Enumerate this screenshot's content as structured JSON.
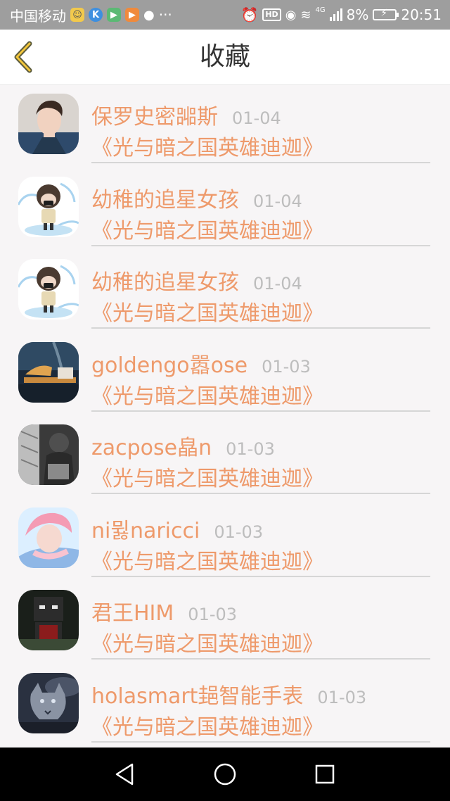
{
  "status_bar": {
    "carrier": "中国移动",
    "more": "···",
    "network": "4G",
    "battery": "8%",
    "time": "20:51",
    "hd": "HD"
  },
  "header": {
    "title": "收藏",
    "back_icon": "chevron-left-icon"
  },
  "favorites": [
    {
      "name": "保罗史密嘂斯",
      "date": "01-04",
      "title": "《光与暗之国英雄迪迦》",
      "avatar": "portrait-man"
    },
    {
      "name": "幼稚的追星女孩",
      "date": "01-04",
      "title": "《光与暗之国英雄迪迦》",
      "avatar": "cartoon-boy"
    },
    {
      "name": "幼稚的追星女孩",
      "date": "01-04",
      "title": "《光与暗之国英雄迪迦》",
      "avatar": "cartoon-boy"
    },
    {
      "name": "goldengo嚣ose",
      "date": "01-03",
      "title": "《光与暗之国英雄迪迦》",
      "avatar": "still-life"
    },
    {
      "name": "zacpose皛n",
      "date": "01-03",
      "title": "《光与暗之国英雄迪迦》",
      "avatar": "dark-figure"
    },
    {
      "name": "ni뮗naricci",
      "date": "01-03",
      "title": "《光与暗之国英雄迪迦》",
      "avatar": "pink-hair"
    },
    {
      "name": "君王HIM",
      "date": "01-03",
      "title": "《光与暗之国英雄迪迦》",
      "avatar": "pixel-character"
    },
    {
      "name": "holasmart郌智能手表",
      "date": "01-03",
      "title": "《光与暗之国英雄迪迦》",
      "avatar": "wolf"
    }
  ],
  "nav_bar": {
    "back": "triangle-back-icon",
    "home": "circle-home-icon",
    "recents": "square-recents-icon"
  }
}
